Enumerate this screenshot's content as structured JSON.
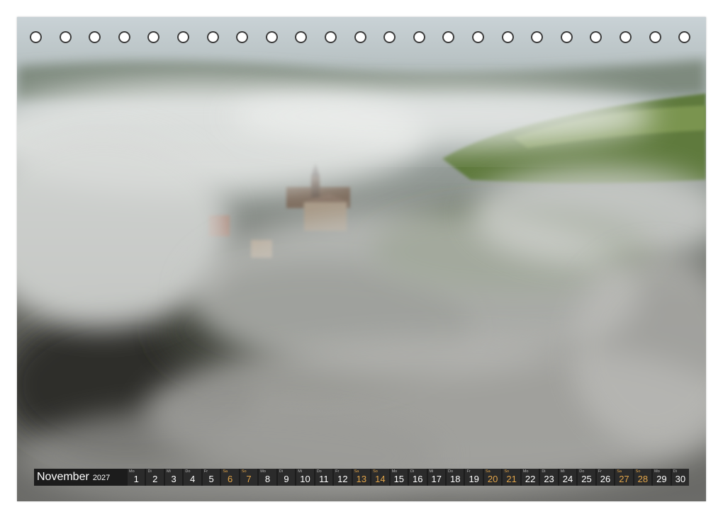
{
  "calendar": {
    "month": "November",
    "year": "2027",
    "weekend_color": "#e2a54a",
    "days": [
      {
        "wd": "Mo",
        "n": "1",
        "we": false
      },
      {
        "wd": "Di",
        "n": "2",
        "we": false
      },
      {
        "wd": "Mi",
        "n": "3",
        "we": false
      },
      {
        "wd": "Do",
        "n": "4",
        "we": false
      },
      {
        "wd": "Fr",
        "n": "5",
        "we": false
      },
      {
        "wd": "Sa",
        "n": "6",
        "we": true
      },
      {
        "wd": "So",
        "n": "7",
        "we": true
      },
      {
        "wd": "Mo",
        "n": "8",
        "we": false
      },
      {
        "wd": "Di",
        "n": "9",
        "we": false
      },
      {
        "wd": "Mi",
        "n": "10",
        "we": false
      },
      {
        "wd": "Do",
        "n": "11",
        "we": false
      },
      {
        "wd": "Fr",
        "n": "12",
        "we": false
      },
      {
        "wd": "Sa",
        "n": "13",
        "we": true
      },
      {
        "wd": "So",
        "n": "14",
        "we": true
      },
      {
        "wd": "Mo",
        "n": "15",
        "we": false
      },
      {
        "wd": "Di",
        "n": "16",
        "we": false
      },
      {
        "wd": "Mi",
        "n": "17",
        "we": false
      },
      {
        "wd": "Do",
        "n": "18",
        "we": false
      },
      {
        "wd": "Fr",
        "n": "19",
        "we": false
      },
      {
        "wd": "Sa",
        "n": "20",
        "we": true
      },
      {
        "wd": "So",
        "n": "21",
        "we": true
      },
      {
        "wd": "Mo",
        "n": "22",
        "we": false
      },
      {
        "wd": "Di",
        "n": "23",
        "we": false
      },
      {
        "wd": "Mi",
        "n": "24",
        "we": false
      },
      {
        "wd": "Do",
        "n": "25",
        "we": false
      },
      {
        "wd": "Fr",
        "n": "26",
        "we": false
      },
      {
        "wd": "Sa",
        "n": "27",
        "we": true
      },
      {
        "wd": "So",
        "n": "28",
        "we": true
      },
      {
        "wd": "Mo",
        "n": "29",
        "we": false
      },
      {
        "wd": "Di",
        "n": "30",
        "we": false
      }
    ]
  },
  "binding": {
    "hole_count": 23
  }
}
